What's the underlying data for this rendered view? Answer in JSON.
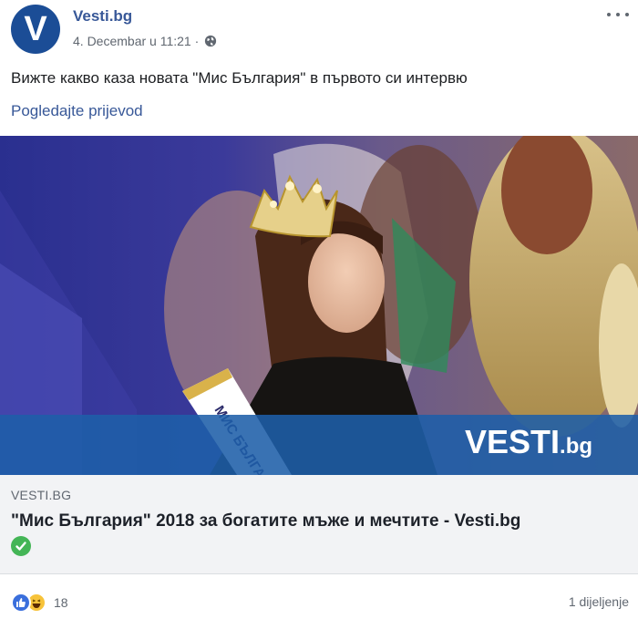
{
  "post": {
    "page_name": "Vesti.bg",
    "avatar_letter": "V",
    "timestamp": "4. Decembar u 11:21 ·",
    "privacy_icon": "globe-icon",
    "more_icon": "more-options-icon",
    "text": "Вижте какво каза новата \"Мис България\" в първото си интервю",
    "translate_label": "Pogledajte prijevod"
  },
  "link_preview": {
    "watermark_main": "VESTI",
    "watermark_suffix": ".bg",
    "sash_text": "МИС БЪЛГАРИЯ",
    "domain": "VESTI.BG",
    "headline": "\"Мис България\" 2018 за богатите мъже и мечтите - Vesti.bg",
    "verified_icon": "check-circle-icon"
  },
  "footer": {
    "reaction_icons": [
      "like-icon",
      "haha-icon"
    ],
    "reaction_count": "18",
    "shares": "1 dijeljenje"
  },
  "colors": {
    "link_blue": "#385898",
    "avatar_blue": "#1b4d96",
    "banner_blue": "#1e5fa8",
    "verified_green": "#44b556"
  }
}
